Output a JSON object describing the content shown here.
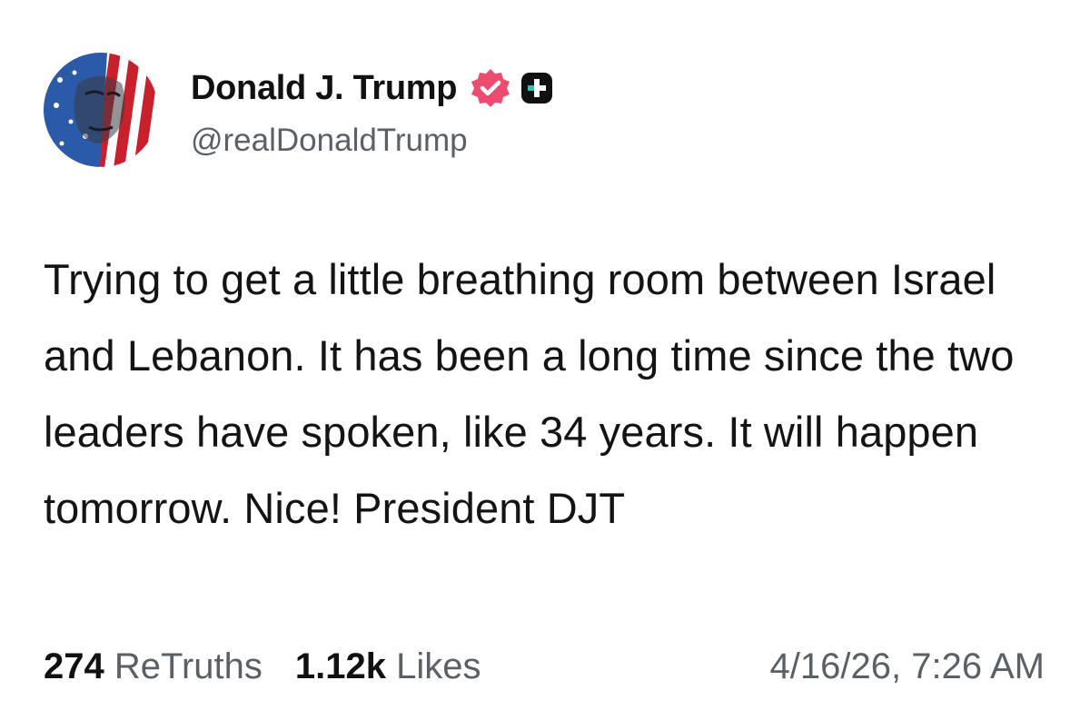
{
  "post": {
    "author": {
      "display_name": "Donald J. Trump",
      "handle": "@realDonaldTrump",
      "verified_badge_icon": "verified-badge-icon",
      "verified_badge_color": "#ec4c6f",
      "plus_badge_icon": "plus-badge-icon",
      "avatar_icon": "avatar-flag-portrait"
    },
    "text": "Trying to get a little breathing room between Israel and Lebanon. It has been a long time since the two leaders have spoken, like 34 years. It will happen tomorrow. Nice! President DJT",
    "stats": {
      "retruths_count": "274",
      "retruths_label": "ReTruths",
      "likes_count": "1.12k",
      "likes_label": "Likes"
    },
    "timestamp": "4/16/26, 7:26 AM"
  },
  "colors": {
    "text_primary": "#111111",
    "text_secondary": "#5b5f66",
    "background": "#ffffff"
  }
}
